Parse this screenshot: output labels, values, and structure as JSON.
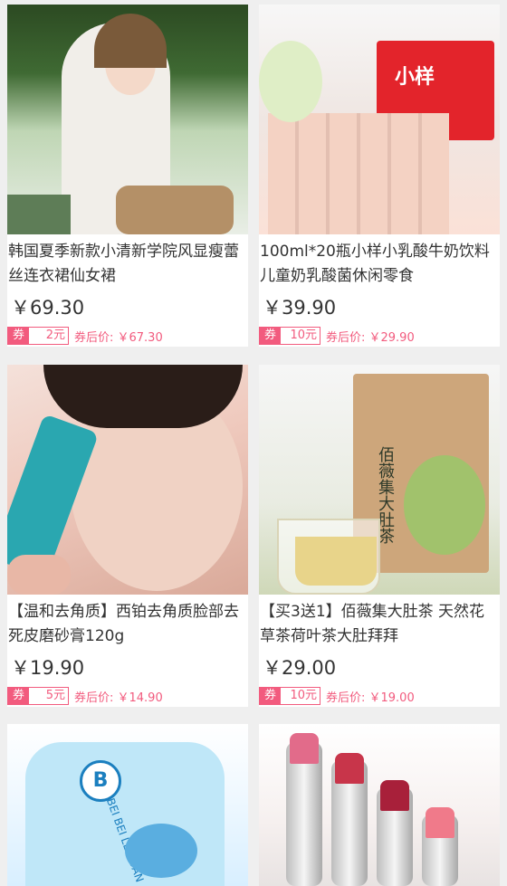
{
  "products": [
    {
      "title": "韩国夏季新款小清新学院风显瘦蕾丝连衣裙仙女裙",
      "price": "￥69.30",
      "coupon_label": "券",
      "coupon_value": "2元",
      "after_price": "券后价: ￥67.30",
      "image_icon": "woman-bicycle-photo"
    },
    {
      "title": "100ml*20瓶小样小乳酸牛奶饮料儿童奶乳酸菌休闲零食",
      "price": "￥39.90",
      "coupon_label": "券",
      "coupon_value": "10元",
      "after_price": "券后价: ￥29.90",
      "image_icon": "yogurt-drink-bottles-photo",
      "image_text": "小样"
    },
    {
      "title": "【温和去角质】西铂去角质脸部去死皮磨砂膏120g",
      "price": "￥19.90",
      "coupon_label": "券",
      "coupon_value": "5元",
      "after_price": "券后价: ￥14.90",
      "image_icon": "face-scrub-tube-photo"
    },
    {
      "title": "【买3送1】佰薇集大肚茶 天然花草茶荷叶茶大肚拜拜",
      "price": "￥29.00",
      "coupon_label": "券",
      "coupon_value": "10元",
      "after_price": "券后价: ￥19.00",
      "image_icon": "tea-bag-photo",
      "image_text": "佰薇集大肚茶"
    },
    {
      "title": "",
      "price": "",
      "coupon_label": "",
      "coupon_value": "",
      "after_price": "",
      "image_icon": "baby-clothes-photo",
      "image_text": "BEI BEI LE YUAN"
    },
    {
      "title": "",
      "price": "",
      "coupon_label": "",
      "coupon_value": "",
      "after_price": "",
      "image_icon": "lipsticks-photo"
    }
  ],
  "colors": {
    "accent": "#f25b7e",
    "background": "#efefef",
    "card": "#ffffff",
    "text": "#333333"
  }
}
